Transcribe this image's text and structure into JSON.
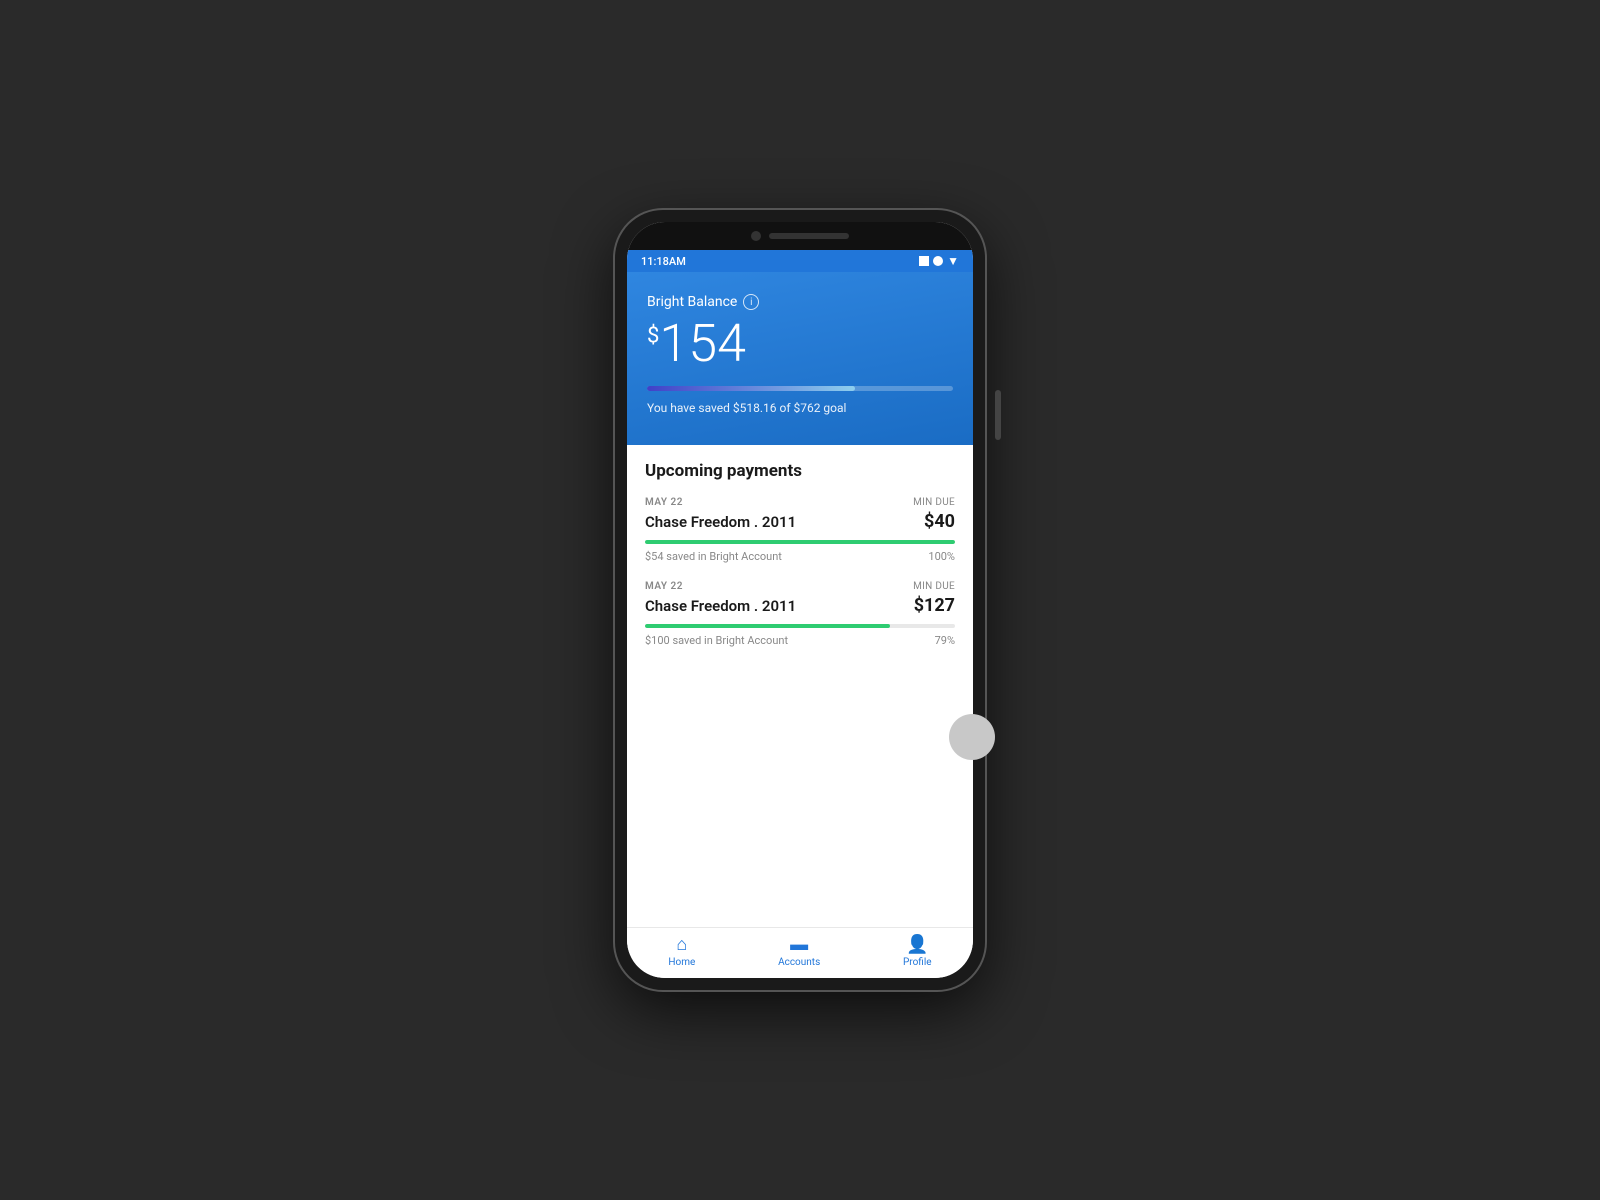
{
  "status_bar": {
    "time": "11:18AM",
    "icons": [
      "square",
      "circle",
      "wifi"
    ]
  },
  "hero": {
    "balance_label": "Bright Balance",
    "balance_amount": "154",
    "balance_currency": "$",
    "savings_progress_pct": 68,
    "savings_text": "You have saved $518.16 of $762 goal"
  },
  "upcoming_payments": {
    "section_title": "Upcoming payments",
    "items": [
      {
        "date": "MAY 22",
        "min_due_label": "MIN DUE",
        "name": "Chase Freedom . 2011",
        "amount": "$40",
        "progress_pct": 100,
        "saved_text": "$54 saved in Bright Account",
        "pct_text": "100%"
      },
      {
        "date": "MAY 22",
        "min_due_label": "MIN DUE",
        "name": "Chase Freedom . 2011",
        "amount": "$127",
        "progress_pct": 79,
        "saved_text": "$100 saved in Bright Account",
        "pct_text": "79%"
      }
    ]
  },
  "nav": {
    "items": [
      {
        "label": "Home",
        "icon": "home",
        "active": true
      },
      {
        "label": "Accounts",
        "icon": "card",
        "active": false
      },
      {
        "label": "Profile",
        "icon": "person",
        "active": false
      }
    ]
  }
}
